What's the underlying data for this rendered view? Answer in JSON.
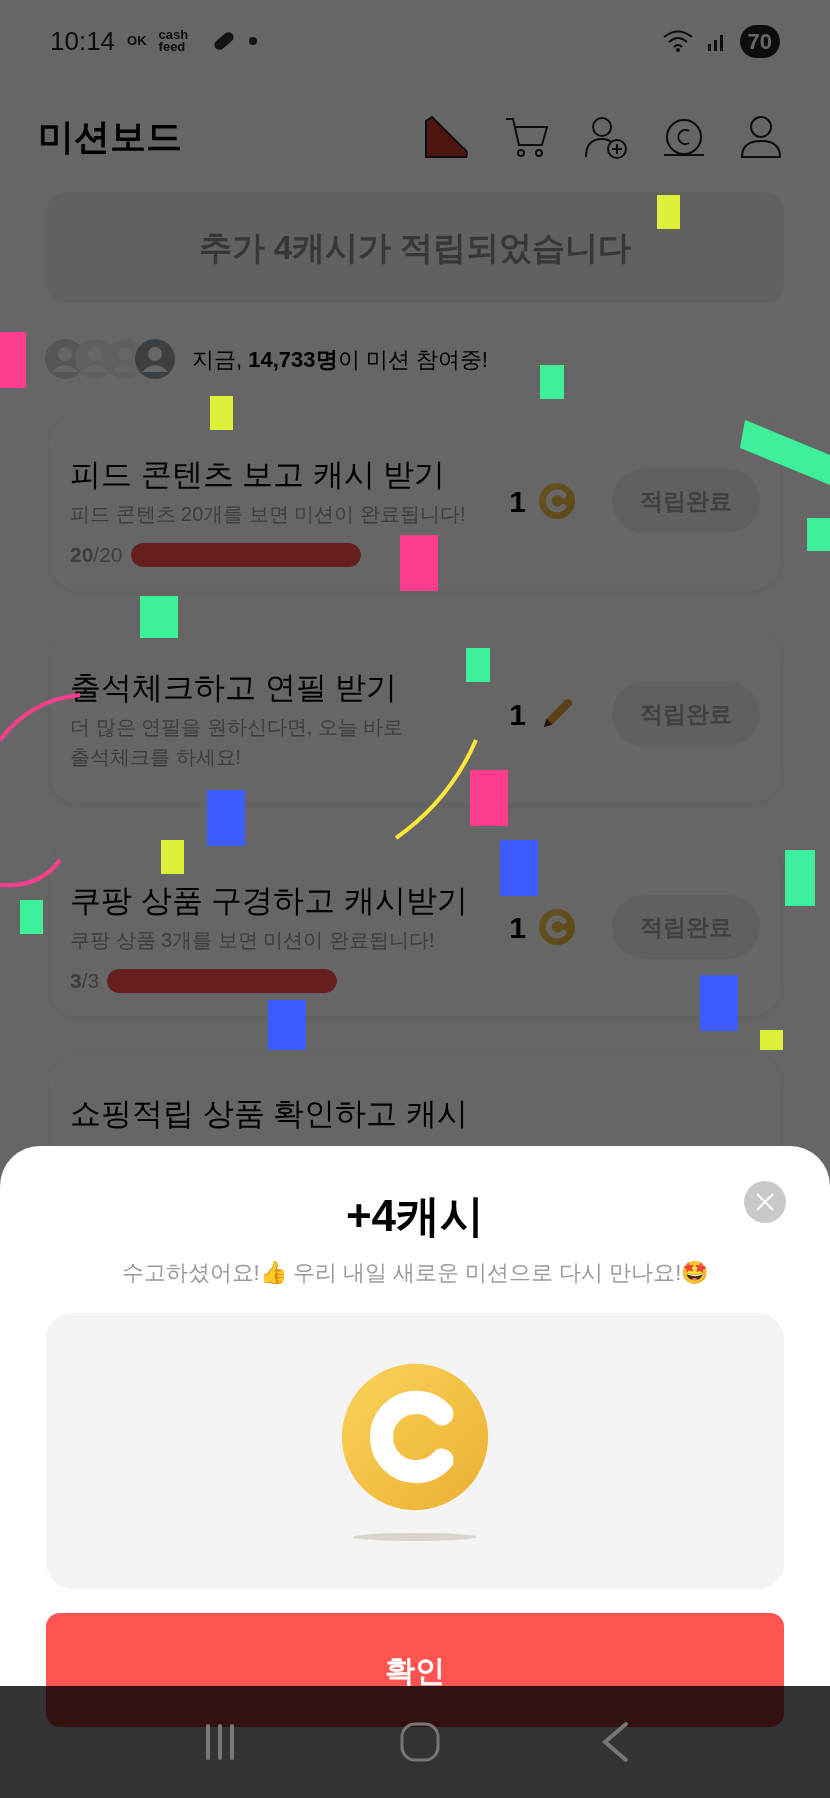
{
  "status_bar": {
    "time": "10:14",
    "notifications": [
      "OK",
      "cash feed"
    ],
    "battery": "70"
  },
  "header": {
    "title": "미션보드"
  },
  "banner": {
    "text": "추가 4캐시가 적립되었습니다"
  },
  "participants": {
    "text": "지금, **14,733명**이 미션 참여중!"
  },
  "missions": [
    {
      "title": "피드 콘텐츠 보고 캐시 받기",
      "description": "피드 콘텐츠 20개를 보면 미션이 완료됩니다!",
      "progress": {
        "count": "**20**/20",
        "level": 1
      },
      "reward": {
        "amount": "1",
        "kind": "coin"
      },
      "button": {
        "label": "적립완료",
        "disabled": true
      }
    },
    {
      "title": "출석체크하고 연필 받기",
      "description": "더 많은 연필을 원하신다면, 오늘 바로 출석체크를 하세요!",
      "reward": {
        "amount": "1",
        "kind": "pencil"
      },
      "button": {
        "label": "적립완료",
        "disabled": true
      }
    },
    {
      "title": "쿠팡 상품 구경하고 캐시받기",
      "description": "쿠팡 상품 3개를 보면 미션이 완료됩니다!",
      "progress": {
        "count": "**3**/3",
        "level": 1
      },
      "reward": {
        "amount": "1",
        "kind": "coin"
      },
      "button": {
        "label": "적립완료",
        "disabled": true
      }
    },
    {
      "title": "쇼핑적립 상품 확인하고 캐시"
    }
  ],
  "dialog": {
    "title": "+4캐시",
    "message": "수고하셨어요!👍 우리 내일 새로운 미션으로 다시 만나요!🤩",
    "confirm": "확인"
  }
}
